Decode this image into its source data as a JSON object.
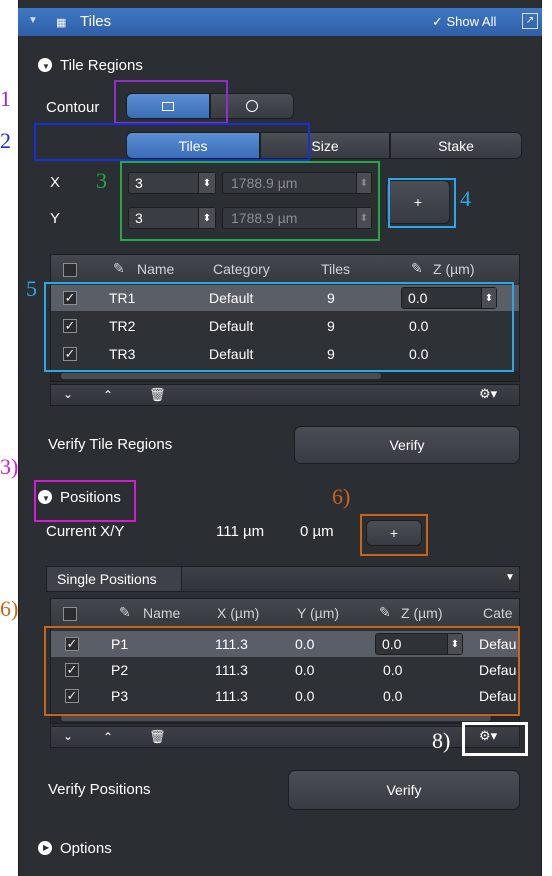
{
  "header": {
    "title": "Tiles",
    "show_all": "Show All"
  },
  "tile_regions": {
    "section_title": "Tile Regions",
    "contour_label": "Contour",
    "tabs": [
      "Tiles",
      "Size",
      "Stake"
    ],
    "x_label": "X",
    "y_label": "Y",
    "x_value": "3",
    "y_value": "3",
    "x_size": "1788.9 µm",
    "y_size": "1788.9 µm",
    "add_symbol": "+",
    "table_headers": [
      "Name",
      "Category",
      "Tiles",
      "Z (µm)"
    ],
    "rows": [
      {
        "name": "TR1",
        "category": "Default",
        "tiles": "9",
        "z": "0.0"
      },
      {
        "name": "TR2",
        "category": "Default",
        "tiles": "9",
        "z": "0.0"
      },
      {
        "name": "TR3",
        "category": "Default",
        "tiles": "9",
        "z": "0.0"
      }
    ],
    "verify_label": "Verify Tile Regions",
    "verify_button": "Verify"
  },
  "positions": {
    "section_title": "Positions",
    "current_label": "Current X/Y",
    "current_x": "111 µm",
    "current_y": "0 µm",
    "add_symbol": "+",
    "tab": "Single Positions",
    "table_headers": [
      "Name",
      "X (µm)",
      "Y (µm)",
      "Z (µm)",
      "Cate"
    ],
    "rows": [
      {
        "name": "P1",
        "x": "111.3",
        "y": "0.0",
        "z": "0.0",
        "cat": "Defau"
      },
      {
        "name": "P2",
        "x": "111.3",
        "y": "0.0",
        "z": "0.0",
        "cat": "Defau"
      },
      {
        "name": "P3",
        "x": "111.3",
        "y": "0.0",
        "z": "0.0",
        "cat": "Defau"
      }
    ],
    "verify_label": "Verify Positions",
    "verify_button": "Verify"
  },
  "options": {
    "section_title": "Options"
  },
  "annotations": {
    "n1": "1",
    "n2": "2",
    "n3": "3",
    "n4": "4",
    "n5": "5",
    "n3b": "3)",
    "n6a": "6)",
    "n6b": "6)",
    "n8": "8)"
  },
  "colors": {
    "purple": "#8e2fc6",
    "blue": "#1730d6",
    "green": "#26a944",
    "cyan": "#2aa7e8",
    "magenta": "#d01ed0",
    "orange": "#c8651a",
    "white": "#ffffff"
  }
}
